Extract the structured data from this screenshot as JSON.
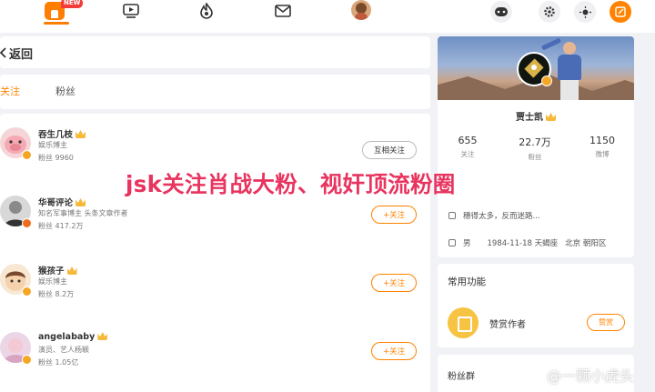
{
  "top_nav": {
    "new_badge": "NEW",
    "accent": "#ff8200",
    "icons": [
      "home-icon",
      "video-icon",
      "hot-icon",
      "message-icon",
      "user-avatar",
      "game-icon",
      "settings-icon",
      "theme-icon",
      "compose-icon"
    ]
  },
  "back_bar": {
    "label": "返回"
  },
  "tabs": [
    {
      "label": "关注",
      "active": true
    },
    {
      "label": "粉丝",
      "active": false
    }
  ],
  "users": [
    {
      "name": "吞生几枝",
      "desc": "娱乐博主",
      "fans": "粉丝 9960",
      "button": "互相关注"
    },
    {
      "name": "华哥评论",
      "desc": "知名军事博主 头条文章作者",
      "fans": "粉丝 417.2万",
      "button": "+关注"
    },
    {
      "name": "猴孩子",
      "desc": "娱乐博主",
      "fans": "粉丝 8.2万",
      "button": "+关注"
    },
    {
      "name": "angelababy",
      "desc": "演员、艺人杨颖",
      "fans": "粉丝 1.05亿",
      "button": "+关注"
    }
  ],
  "profile": {
    "name": "贾士凯",
    "stats": [
      {
        "num": "655",
        "label": "关注"
      },
      {
        "num": "22.7万",
        "label": "粉丝"
      },
      {
        "num": "1150",
        "label": "微博"
      }
    ],
    "bio": "穗得太多，反而迷路...",
    "gender": "男",
    "birthday": "1984-11-18 天蝎座",
    "location": "北京 朝阳区"
  },
  "functions": {
    "title": "常用功能",
    "item_label": "赞赏作者",
    "item_button": "赞赏"
  },
  "fans_group": {
    "title": "粉丝群"
  },
  "overlay": {
    "text": "jsk关注肖战大粉、视奸顶流粉圈",
    "color": "#e8345f"
  },
  "watermark": {
    "text": "@一颗小虎头"
  }
}
